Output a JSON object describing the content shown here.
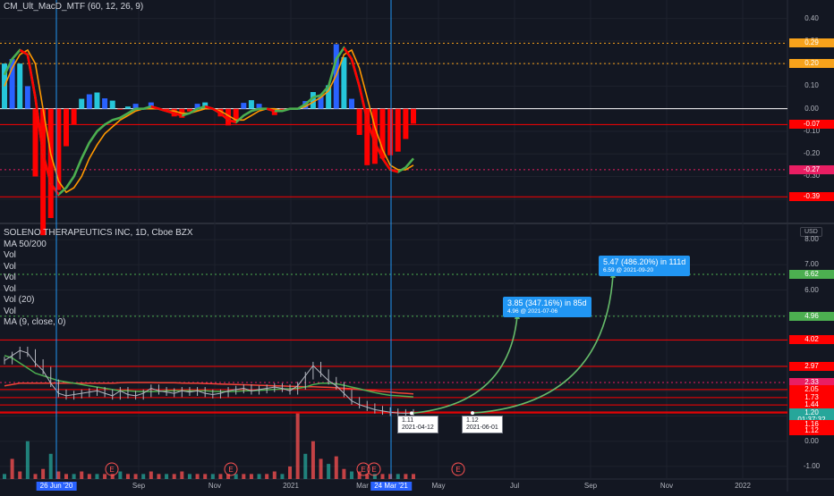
{
  "indicator": {
    "title": "CM_Ult_MacD_MTF (60, 12, 26, 9)",
    "axis_ticks": [
      "0.40",
      "0.30",
      "0.20",
      "0.10",
      "0.00",
      "-0.10",
      "-0.20",
      "-0.30",
      "-0.40"
    ],
    "levels": [
      {
        "text": "0.29",
        "color": "#f7a21b",
        "style": "dotted"
      },
      {
        "text": "0.20",
        "color": "#f7a21b",
        "style": "dotted"
      },
      {
        "text": "-0.07",
        "color": "#ff0000",
        "style": "solid"
      },
      {
        "text": "-0.27",
        "color": "#e91e63",
        "style": "dotted"
      },
      {
        "text": "-0.39",
        "color": "#ff0000",
        "style": "solid"
      }
    ]
  },
  "main": {
    "symbol": "SOLENO THERAPEUTICS INC, 1D, Cboe BZX",
    "legend_items": [
      "MA 50/200",
      "Vol",
      "Vol",
      "Vol",
      "Vol",
      "Vol (20)",
      "Vol",
      "MA (9, close, 0)"
    ],
    "currency": "USD",
    "axis_ticks": [
      "8.00",
      "7.00",
      "6.00",
      "5.00",
      "4.00",
      "3.00",
      "2.00",
      "1.00",
      "0.00",
      "-1.00"
    ],
    "price_tags": [
      {
        "text": "6.62",
        "bg": "#4caf50",
        "fg": "#ffffff"
      },
      {
        "text": "4.96",
        "bg": "#4caf50",
        "fg": "#ffffff"
      },
      {
        "text": "4.02",
        "bg": "#ff0000",
        "fg": "#ffffff"
      },
      {
        "text": "2.97",
        "bg": "#ff0000",
        "fg": "#ffffff"
      },
      {
        "text": "2.33",
        "bg": "#e91e63",
        "fg": "#ffffff"
      },
      {
        "text": "2.05",
        "bg": "#ff0000",
        "fg": "#ffffff"
      },
      {
        "text": "1.73",
        "bg": "#ff0000",
        "fg": "#ffffff"
      },
      {
        "text": "1.44",
        "bg": "#ff0000",
        "fg": "#ffffff"
      },
      {
        "text": "1.20",
        "bg": "#26a69a",
        "fg": "#ffffff"
      },
      {
        "text": "01:37:32",
        "bg": "#26a69a",
        "fg": "#ffffff"
      },
      {
        "text": "1.16",
        "bg": "#ff0000",
        "fg": "#ffffff"
      },
      {
        "text": "1.12",
        "bg": "#ff0000",
        "fg": "#ffffff"
      }
    ],
    "callouts": [
      {
        "title": "3.85 (347.16%) in 85d",
        "sub": "4.96 @ 2021-07-06"
      },
      {
        "title": "5.47 (486.20%) in 111d",
        "sub": "6.59 @ 2021-09-20"
      }
    ],
    "low_labels": [
      {
        "price": "1.11",
        "date": "2021-04-12"
      },
      {
        "price": "1.12",
        "date": "2021-06-01"
      }
    ],
    "events": [
      "E",
      "E",
      "E",
      "E",
      "E"
    ]
  },
  "time_axis": {
    "labels": [
      {
        "text": "26 Jun '20",
        "highlight": true
      },
      {
        "text": "Sep",
        "highlight": false
      },
      {
        "text": "Nov",
        "highlight": false
      },
      {
        "text": "2021",
        "highlight": false
      },
      {
        "text": "Mar",
        "highlight": false
      },
      {
        "text": "24 Mar '21",
        "highlight": true
      },
      {
        "text": "May",
        "highlight": false
      },
      {
        "text": "Jul",
        "highlight": false
      },
      {
        "text": "Sep",
        "highlight": false
      },
      {
        "text": "Nov",
        "highlight": false
      },
      {
        "text": "2022",
        "highlight": false
      }
    ]
  },
  "colors": {
    "background": "#131722",
    "grid": "#1e222d",
    "macd_up": "#2962ff",
    "macd_up_light": "#26c6da",
    "macd_down": "#ff0000",
    "fast_line": "#4caf50",
    "slow_line": "#ff9800",
    "vertical_marker": "#2196f3",
    "ma50": "#4caf50",
    "ma200": "#f44336",
    "price_line": "#b2b5be",
    "projection": "#66bb6a"
  },
  "chart_data": {
    "type": "line",
    "macd_pane": {
      "ylim": [
        -0.5,
        0.45
      ],
      "macd_line": [
        0.15,
        0.22,
        0.26,
        0.24,
        0.05,
        -0.2,
        -0.33,
        -0.38,
        -0.35,
        -0.3,
        -0.22,
        -0.15,
        -0.1,
        -0.07,
        -0.05,
        -0.04,
        -0.02,
        0.0,
        0.0,
        0.01,
        0.0,
        -0.01,
        -0.02,
        -0.03,
        -0.02,
        0.0,
        0.01,
        0.0,
        -0.02,
        -0.05,
        -0.06,
        -0.03,
        -0.01,
        0.0,
        0.0,
        -0.01,
        -0.01,
        0.0,
        0.0,
        0.02,
        0.05,
        0.06,
        0.1,
        0.22,
        0.27,
        0.22,
        0.1,
        -0.05,
        -0.15,
        -0.22,
        -0.27,
        -0.28,
        -0.26,
        -0.22
      ],
      "signal_line": [
        0.1,
        0.18,
        0.24,
        0.26,
        0.2,
        0.0,
        -0.2,
        -0.32,
        -0.37,
        -0.35,
        -0.3,
        -0.22,
        -0.16,
        -0.11,
        -0.08,
        -0.05,
        -0.03,
        -0.01,
        0.0,
        0.0,
        0.0,
        -0.01,
        -0.01,
        -0.02,
        -0.02,
        -0.01,
        0.0,
        0.0,
        -0.01,
        -0.03,
        -0.05,
        -0.05,
        -0.03,
        -0.01,
        0.0,
        0.0,
        -0.01,
        0.0,
        0.0,
        0.01,
        0.03,
        0.05,
        0.08,
        0.15,
        0.24,
        0.26,
        0.18,
        0.05,
        -0.08,
        -0.18,
        -0.25,
        -0.27,
        -0.27,
        -0.25
      ]
    },
    "price_pane": {
      "ylim": [
        -1.5,
        8.5
      ],
      "close": [
        3.2,
        3.4,
        3.6,
        3.5,
        3.1,
        2.8,
        2.3,
        1.9,
        1.8,
        1.85,
        1.9,
        1.95,
        2.0,
        1.9,
        1.8,
        2.0,
        1.85,
        1.8,
        1.9,
        2.1,
        2.0,
        1.95,
        1.9,
        2.0,
        1.95,
        2.0,
        1.9,
        1.85,
        1.9,
        2.0,
        2.05,
        2.1,
        2.0,
        2.05,
        2.1,
        2.15,
        2.1,
        2.0,
        2.2,
        2.6,
        3.0,
        2.7,
        2.4,
        2.2,
        1.9,
        1.6,
        1.45,
        1.35,
        1.25,
        1.2,
        1.15,
        1.12,
        1.11,
        1.12
      ],
      "ma50": [
        3.4,
        3.3,
        3.1,
        2.9,
        2.7,
        2.6,
        2.5,
        2.4,
        2.35,
        2.3,
        2.25,
        2.2,
        2.15,
        2.1,
        2.05,
        2.0,
        2.0,
        1.98,
        1.97,
        1.97,
        1.98,
        2.0,
        2.0,
        2.0,
        2.0,
        2.0,
        2.0,
        1.98,
        1.97,
        1.97,
        1.98,
        2.0,
        2.0,
        2.02,
        2.04,
        2.06,
        2.07,
        2.08,
        2.1,
        2.15,
        2.25,
        2.3,
        2.3,
        2.28,
        2.22,
        2.15,
        2.08,
        2.0,
        1.93,
        1.87,
        1.82,
        1.8,
        1.78,
        1.76
      ],
      "ma200": [
        2.2,
        2.25,
        2.3,
        2.3,
        2.3,
        2.3,
        2.3,
        2.3,
        2.3,
        2.3,
        2.3,
        2.3,
        2.3,
        2.3,
        2.3,
        2.32,
        2.33,
        2.33,
        2.33,
        2.33,
        2.32,
        2.32,
        2.32,
        2.31,
        2.3,
        2.3,
        2.29,
        2.28,
        2.27,
        2.26,
        2.25,
        2.24,
        2.23,
        2.22,
        2.21,
        2.2,
        2.19,
        2.18,
        2.17,
        2.16,
        2.16,
        2.15,
        2.14,
        2.12,
        2.1,
        2.08,
        2.05,
        2.02,
        2.0,
        1.97,
        1.95,
        1.92,
        1.9,
        1.88
      ],
      "volume": [
        0.2,
        0.8,
        0.3,
        1.5,
        0.2,
        0.4,
        1.0,
        0.3,
        0.2,
        0.2,
        0.3,
        0.2,
        0.2,
        0.2,
        0.2,
        0.3,
        0.2,
        0.2,
        0.2,
        0.3,
        0.2,
        0.2,
        0.2,
        0.3,
        0.2,
        0.2,
        0.2,
        0.2,
        0.2,
        0.2,
        0.2,
        0.2,
        0.2,
        0.2,
        0.2,
        0.3,
        0.2,
        0.5,
        2.6,
        1.0,
        1.5,
        0.8,
        0.6,
        0.9,
        0.4,
        0.3,
        0.3,
        0.2,
        0.2,
        0.2,
        0.2,
        0.2,
        0.2,
        0.2
      ],
      "projections": [
        {
          "from": {
            "date": "2021-04-12",
            "price": 1.11
          },
          "to": {
            "date": "2021-07-06",
            "price": 4.96
          }
        },
        {
          "from": {
            "date": "2021-06-01",
            "price": 1.12
          },
          "to": {
            "date": "2021-09-20",
            "price": 6.59
          }
        }
      ]
    }
  }
}
